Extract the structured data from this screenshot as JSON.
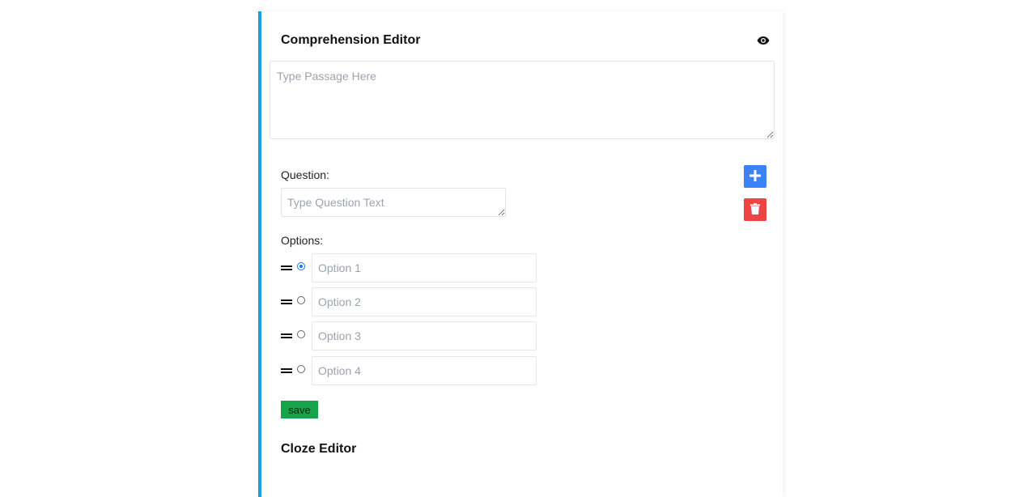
{
  "editor": {
    "title": "Comprehension Editor",
    "preview_icon": "eye-icon",
    "passage_placeholder": "Type Passage Here",
    "passage_value": ""
  },
  "question": {
    "label": "Question:",
    "placeholder": "Type Question Text",
    "value": "",
    "add_icon": "plus-icon",
    "delete_icon": "trash-icon",
    "add_color": "#3b82f6",
    "delete_color": "#ef4444"
  },
  "options": {
    "label": "Options:",
    "drag_icon": "drag-handle-icon",
    "selected_index": 0,
    "items": [
      {
        "placeholder": "Option 1",
        "value": ""
      },
      {
        "placeholder": "Option 2",
        "value": ""
      },
      {
        "placeholder": "Option 3",
        "value": ""
      },
      {
        "placeholder": "Option 4",
        "value": ""
      }
    ]
  },
  "save_label": "save",
  "next_section_title": "Cloze Editor",
  "colors": {
    "accent_border": "#1a9fe0",
    "save": "#16a34a",
    "radio_selected": "#1a73e8"
  }
}
